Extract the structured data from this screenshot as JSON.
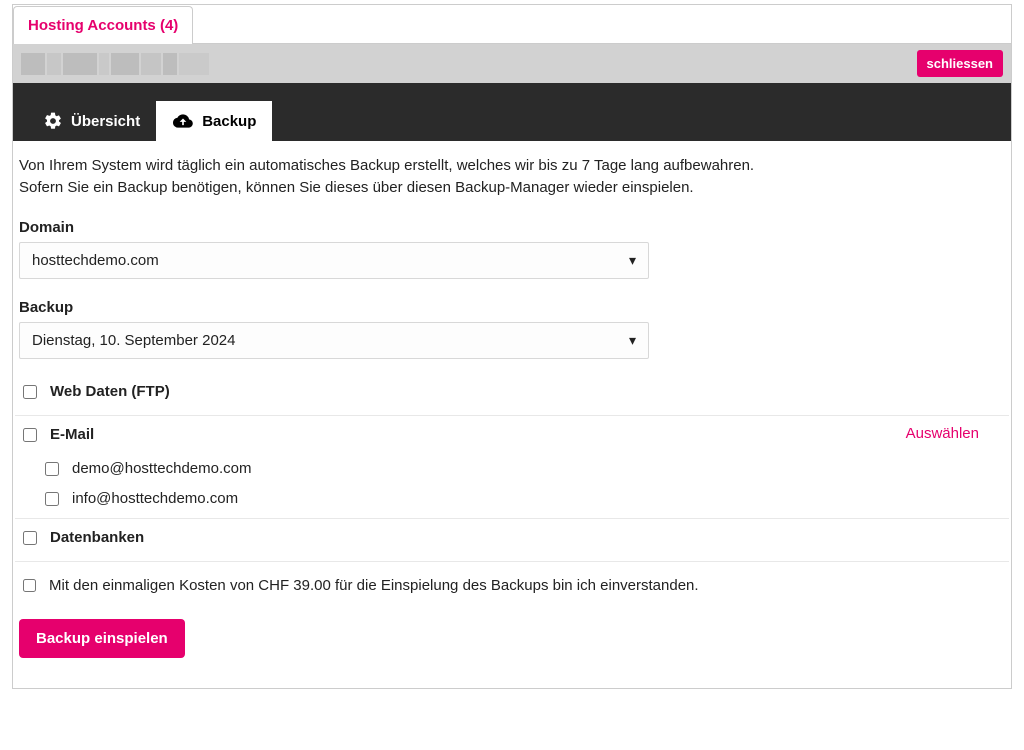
{
  "topTab": "Hosting Accounts (4)",
  "close": "schliessen",
  "nav": {
    "overview": "Übersicht",
    "backup": "Backup"
  },
  "intro": {
    "line1": "Von Ihrem System wird täglich ein automatisches Backup erstellt, welches wir bis zu 7 Tage lang aufbewahren.",
    "line2": "Sofern Sie ein Backup benötigen, können Sie dieses über diesen Backup-Manager wieder einspielen."
  },
  "labels": {
    "domain": "Domain",
    "backup": "Backup",
    "webdata": "Web Daten (FTP)",
    "email": "E-Mail",
    "databases": "Datenbanken",
    "select": "Auswählen",
    "agree": "Mit den einmaligen Kosten von CHF 39.00 für die Einspielung des Backups bin ich einverstanden.",
    "submit": "Backup einspielen"
  },
  "domain": "hosttechdemo.com",
  "backupDate": "Dienstag, 10. September 2024",
  "emails": [
    "demo@hosttechdemo.com",
    "info@hosttechdemo.com"
  ]
}
